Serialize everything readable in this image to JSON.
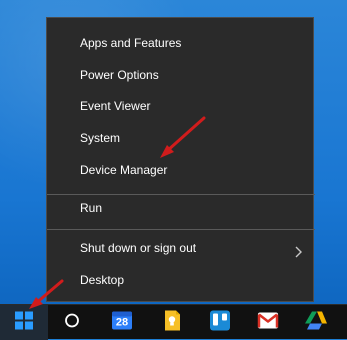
{
  "menu": {
    "items": [
      {
        "label": "Apps and Features"
      },
      {
        "label": "Power Options"
      },
      {
        "label": "Event Viewer"
      },
      {
        "label": "System"
      },
      {
        "label": "Device Manager"
      },
      {
        "label": "Run"
      },
      {
        "label": "Shut down or sign out"
      },
      {
        "label": "Desktop"
      }
    ]
  },
  "taskbar": {
    "calendar_day": "28",
    "icons": [
      {
        "name": "windows-start-icon"
      },
      {
        "name": "cortana-search-icon"
      },
      {
        "name": "calendar-icon"
      },
      {
        "name": "google-keep-icon"
      },
      {
        "name": "trello-icon"
      },
      {
        "name": "gmail-icon"
      },
      {
        "name": "google-drive-icon"
      }
    ]
  },
  "colors": {
    "desktop": "#1d7fd6",
    "menu_bg": "#2a2a2a",
    "menu_text": "#ffffff",
    "taskbar_bg": "#111111",
    "annotation_arrow": "#d11c1c"
  }
}
